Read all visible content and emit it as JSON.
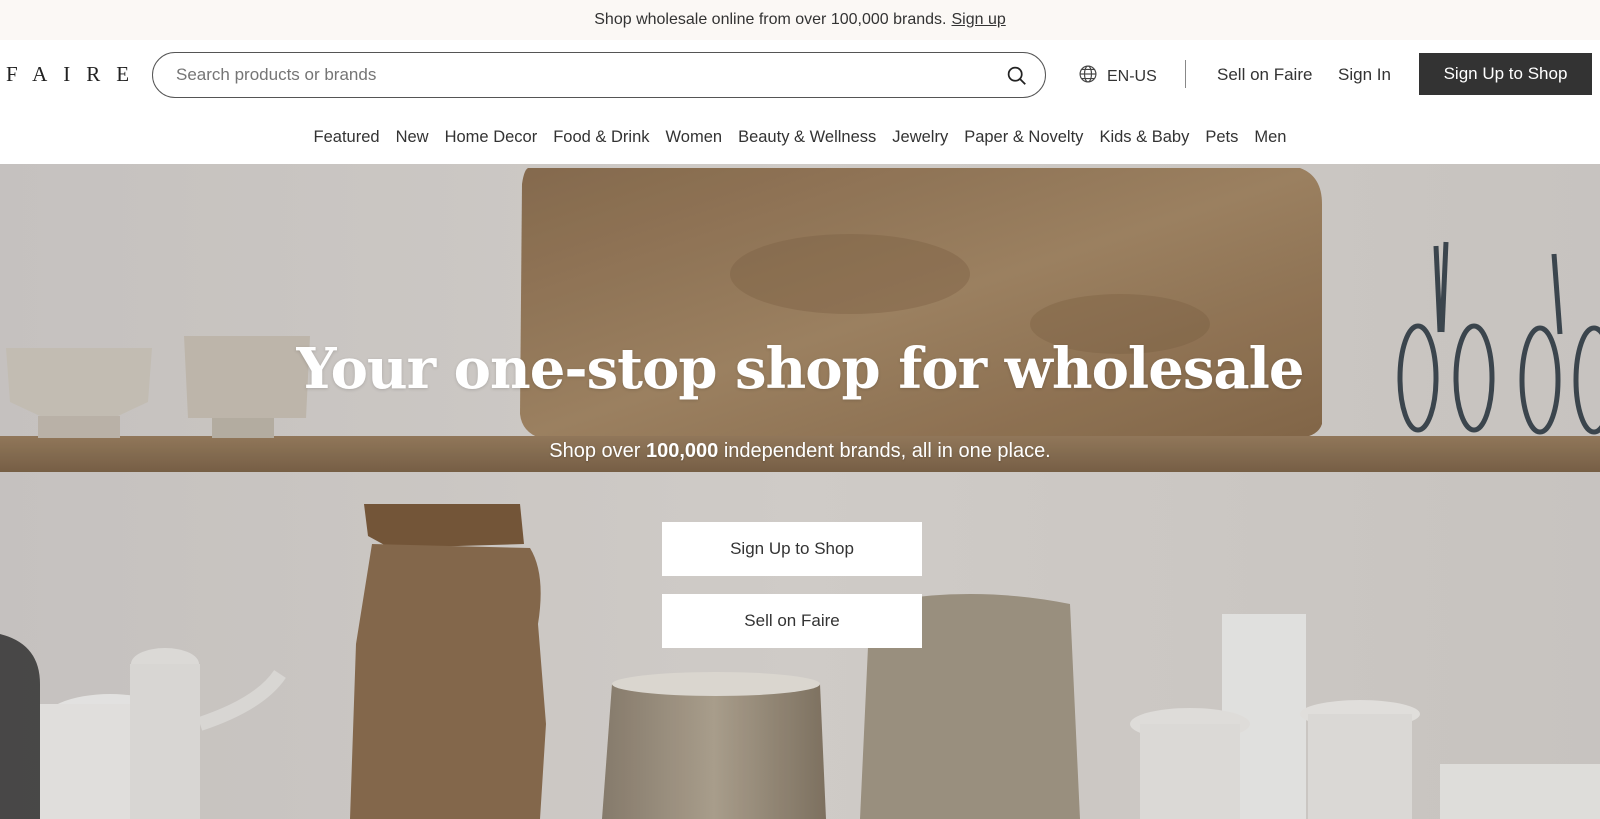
{
  "announcement": {
    "text": "Shop wholesale online from over 100,000 brands.",
    "link": "Sign up"
  },
  "header": {
    "logo": "FAIRE",
    "search_placeholder": "Search products or brands",
    "search_icon": "search-icon",
    "language": "EN-US",
    "language_icon": "globe-icon",
    "sell_link": "Sell on Faire",
    "signin_link": "Sign In",
    "signup_button": "Sign Up to Shop"
  },
  "categories": [
    "Featured",
    "New",
    "Home Decor",
    "Food & Drink",
    "Women",
    "Beauty & Wellness",
    "Jewelry",
    "Paper & Novelty",
    "Kids & Baby",
    "Pets",
    "Men"
  ],
  "hero": {
    "title": "Your one-stop shop for wholesale",
    "subtitle_before": "Shop over",
    "subtitle_bold": "100,000",
    "subtitle_after": "independent brands, all in one place.",
    "primary_button": "Sign Up to Shop",
    "secondary_button": "Sell on Faire"
  },
  "colors": {
    "announcement_bg": "#fbf8f5",
    "dark_button": "#333333",
    "text": "#333333",
    "white": "#ffffff"
  }
}
